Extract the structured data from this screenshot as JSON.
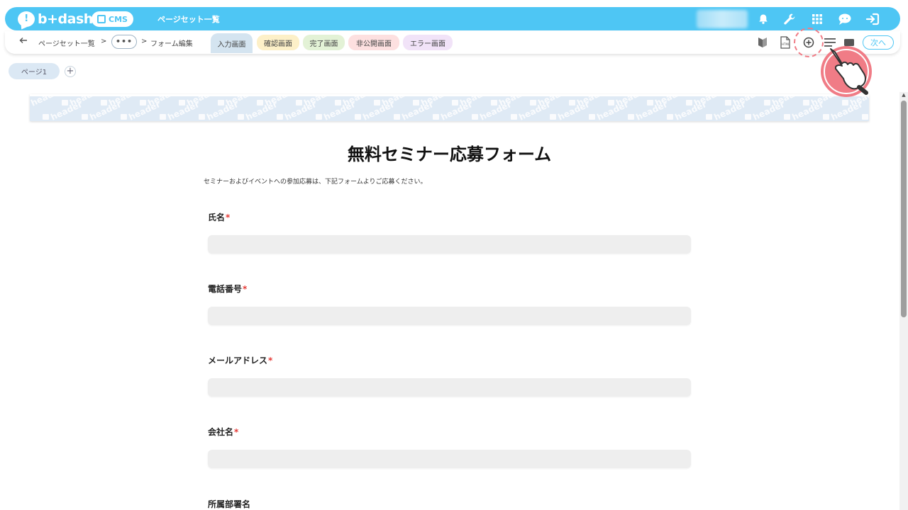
{
  "topbar": {
    "brand": "b+dash",
    "cms_label": "CMS",
    "title": "ページセット一覧",
    "icons": [
      "bell-icon",
      "wrench-icon",
      "apps-grid-icon",
      "chat-icon",
      "logout-icon"
    ]
  },
  "breadcrumb": {
    "back_icon": "arrow-left-icon",
    "item1": "ページセット一覧",
    "sep": ">",
    "more": "•••",
    "item2": "フォーム編集"
  },
  "tabs": [
    {
      "label": "入力画面",
      "color": "#d4e4f0"
    },
    {
      "label": "確認画面",
      "color": "#fdf0c8"
    },
    {
      "label": "完了画面",
      "color": "#e3f2d6"
    },
    {
      "label": "非公開画面",
      "color": "#fde0e0"
    },
    {
      "label": "エラー画面",
      "color": "#f1e3f8"
    }
  ],
  "toolbar": {
    "icons": [
      "beginner-icon",
      "html-file-icon",
      "add-circle-icon",
      "list-icon",
      "square-icon"
    ],
    "next_label": "次へ"
  },
  "pages": {
    "page1": "ページ1",
    "add": "+"
  },
  "banner": {
    "watermark": "header"
  },
  "form": {
    "title": "無料セミナー応募フォーム",
    "description": "セミナーおよびイベントへの参加応募は、下記フォームよりご応募ください。",
    "required_mark": "*",
    "fields": [
      {
        "label": "氏名",
        "required": true
      },
      {
        "label": "電話番号",
        "required": true
      },
      {
        "label": "メールアドレス",
        "required": true
      },
      {
        "label": "会社名",
        "required": true
      },
      {
        "label": "所属部署名",
        "required": false
      }
    ]
  },
  "colors": {
    "accent": "#4ec6f4",
    "required": "#e53935",
    "pointer": "#f07c86"
  }
}
